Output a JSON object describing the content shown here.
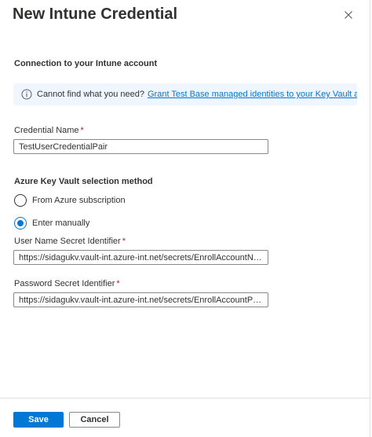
{
  "panel": {
    "title": "New Intune Credential",
    "close_icon": "close-icon"
  },
  "connection": {
    "heading": "Connection to your Intune account",
    "info": {
      "icon": "info-icon",
      "text": "Cannot find what you need?",
      "link": "Grant Test Base managed identities to your Key Vault account",
      "link_icon": "external-link-icon"
    }
  },
  "credential_name": {
    "label": "Credential Name",
    "required_mark": "*",
    "value": "TestUserCredentialPair"
  },
  "key_vault": {
    "heading": "Azure Key Vault selection method",
    "options": [
      {
        "label": "From Azure subscription",
        "selected": false
      },
      {
        "label": "Enter manually",
        "selected": true
      }
    ]
  },
  "user_name_secret": {
    "label": "User Name Secret Identifier",
    "required_mark": "*",
    "value": "https://sidagukv.vault-int.azure-int.net/secrets/EnrollAccountNa..."
  },
  "password_secret": {
    "label": "Password Secret Identifier",
    "required_mark": "*",
    "value": "https://sidagukv.vault-int.azure-int.net/secrets/EnrollAccountPas..."
  },
  "footer": {
    "save_label": "Save",
    "cancel_label": "Cancel"
  },
  "colors": {
    "accent": "#0078d4",
    "info_background": "#f0f6ff",
    "required": "#a4262c"
  }
}
